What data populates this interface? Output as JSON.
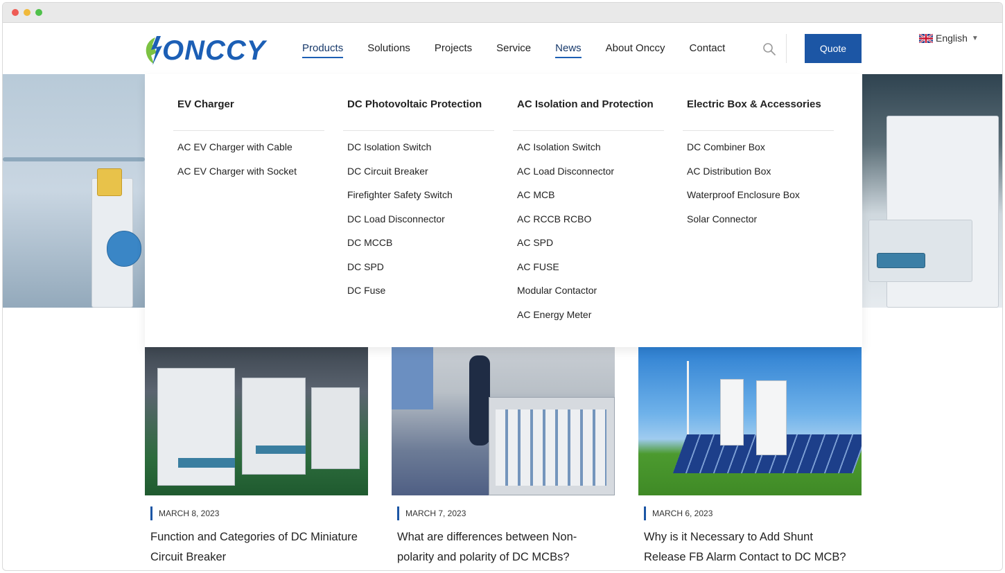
{
  "brand": {
    "logo_text": "ONCCY"
  },
  "nav": {
    "items": [
      {
        "label": "Products"
      },
      {
        "label": "Solutions"
      },
      {
        "label": "Projects"
      },
      {
        "label": "Service"
      },
      {
        "label": "News"
      },
      {
        "label": "About Onccy"
      },
      {
        "label": "Contact"
      }
    ],
    "quote_label": "Quote",
    "language": "English"
  },
  "mega_menu": {
    "columns": [
      {
        "heading": "EV Charger",
        "items": [
          "AC EV Charger with Cable",
          "AC EV Charger with Socket"
        ]
      },
      {
        "heading": "DC Photovoltaic Protection",
        "items": [
          "DC Isolation Switch",
          "DC Circuit Breaker",
          "Firefighter Safety Switch",
          "DC Load Disconnector",
          "DC MCCB",
          "DC SPD",
          "DC Fuse"
        ]
      },
      {
        "heading": "AC Isolation and Protection",
        "items": [
          "AC Isolation Switch",
          "AC Load Disconnector",
          "AC MCB",
          "AC RCCB RCBO",
          "AC SPD",
          "AC FUSE",
          "Modular Contactor",
          "AC Energy Meter"
        ]
      },
      {
        "heading": "Electric Box & Accessories",
        "items": [
          "DC Combiner Box",
          "AC Distribution Box",
          "Waterproof Enclosure Box",
          "Solar Connector"
        ]
      }
    ]
  },
  "news": {
    "cards": [
      {
        "date": "MARCH 8, 2023",
        "title": "Function and Categories of DC Miniature Circuit Breaker"
      },
      {
        "date": "MARCH 7, 2023",
        "title": "What are differences between Non-polarity and polarity of DC MCBs?"
      },
      {
        "date": "MARCH 6, 2023",
        "title": "Why is it Necessary to Add Shunt Release FB Alarm Contact to DC MCB?"
      }
    ]
  },
  "colors": {
    "brand_blue": "#1c56a5",
    "logo_green": "#7cc242"
  }
}
